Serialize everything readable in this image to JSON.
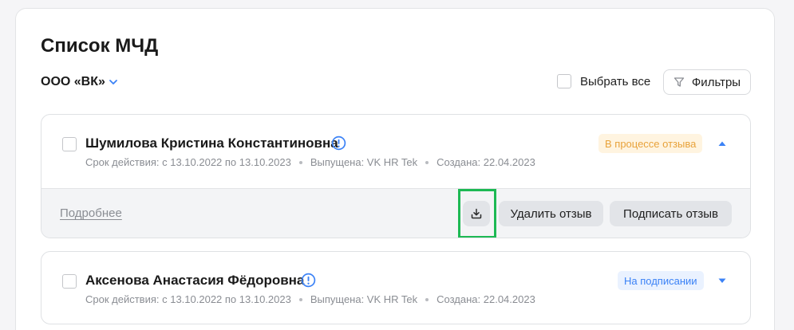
{
  "page": {
    "title": "Список МЧД"
  },
  "org_selector": {
    "label": "ООО «ВК»"
  },
  "select_all": {
    "label": "Выбрать все"
  },
  "filters": {
    "label": "Фильтры"
  },
  "colors": {
    "accent": "#3b82f6",
    "highlight": "#1db954",
    "status_orange": "#e8a23a"
  },
  "cards": [
    {
      "name": "Шумилова Кристина Константиновна",
      "validity": "Срок действия: с 13.10.2022 по 13.10.2023",
      "issued": "Выпущена: VK HR Tek",
      "created": "Создана: 22.04.2023",
      "status": "В процессе отзыва",
      "expanded": true,
      "details_link": "Подробнее",
      "download_icon": "download-icon",
      "revoke_label": "Удалить отзыв",
      "sign_label": "Подписать отзыв"
    },
    {
      "name": "Аксенова Анастасия Фёдоровна",
      "validity": "Срок действия: с 13.10.2022 по 13.10.2023",
      "issued": "Выпущена: VK HR Tek",
      "created": "Создана: 22.04.2023",
      "status": "На подписании",
      "expanded": false
    }
  ]
}
